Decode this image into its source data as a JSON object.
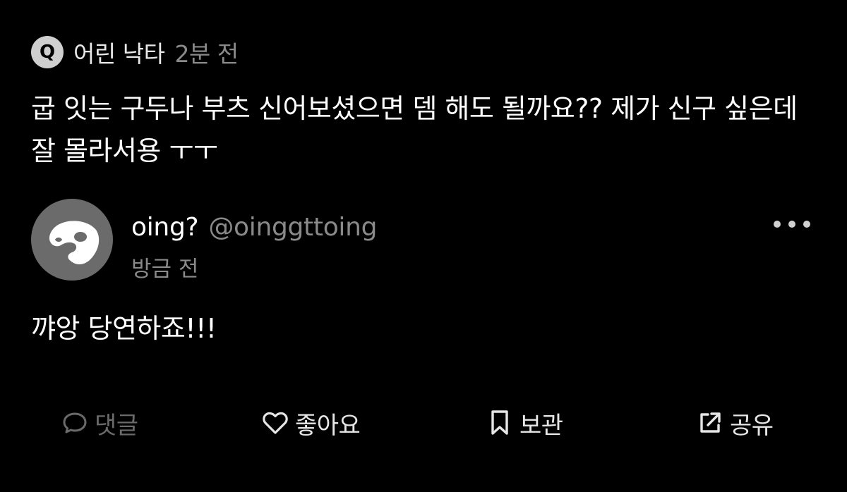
{
  "question": {
    "badge": "Q",
    "author": "어린 낙타",
    "time": "2분 전",
    "text": "굽 잇는 구두나 부츠 신어보셨으면 뎀 해도 될까요?? 제가 신구 싶은데 잘 몰라서용 ㅜㅜ"
  },
  "answer": {
    "display_name": "oing?",
    "handle": "@oinggttoing",
    "time": "방금 전",
    "text": "꺄앙 당연하죠!!!"
  },
  "actions": {
    "comment_label": "댓글",
    "like_label": "좋아요",
    "save_label": "보관",
    "share_label": "공유"
  },
  "icons": {
    "comment": "speech-bubble-icon",
    "like": "heart-icon",
    "save": "bookmark-icon",
    "share": "external-share-icon",
    "more": "more-dots-icon"
  },
  "colors": {
    "background": "#000000",
    "primary_text": "#ffffff",
    "secondary_text": "#8a8a8a",
    "avatar_bg": "#6b6b6b",
    "badge_bg": "#cfcfcf"
  }
}
